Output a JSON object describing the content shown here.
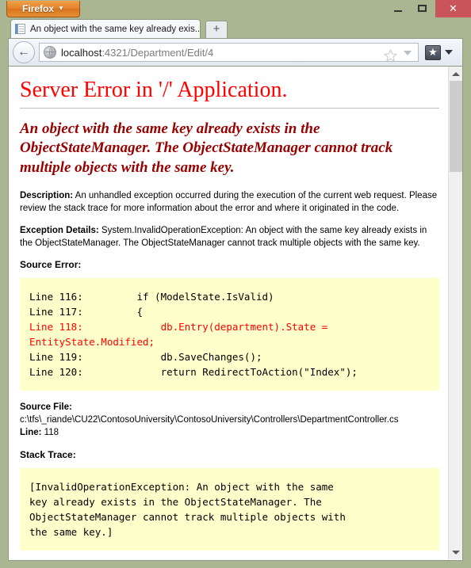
{
  "window": {
    "titlebar": {
      "firefox_button": "Firefox",
      "firefox_caret": "▼",
      "minimize_label": "Minimize",
      "maximize_label": "Maximize",
      "close_label": "✕"
    },
    "colors": {
      "chrome": "#a9b691",
      "close_button": "#c9555a",
      "firefox_orange": "#e2832c",
      "error_red": "#ff0000",
      "message_dark_red": "#990000",
      "code_background": "#ffffcc"
    }
  },
  "tabs": {
    "active": {
      "title": "An object with the same key already exis...",
      "favicon": "document-icon"
    },
    "new_tab_label": "+"
  },
  "navbar": {
    "back_label": "←",
    "url_host": "localhost",
    "url_rest": ":4321/Department/Edit/4",
    "url_full": "localhost:4321/Department/Edit/4",
    "identity_icon": "globe-icon",
    "bookmark_star": "star-icon",
    "url_dropdown": "chevron-down-icon",
    "bookmarks_icon": "bookmarks-star-icon",
    "bookmarks_caret": "chevron-down-icon"
  },
  "page": {
    "title": "Server Error in '/' Application.",
    "message": "An object with the same key already exists in the ObjectStateManager. The ObjectStateManager cannot track multiple objects with the same key.",
    "description_label": "Description:",
    "description_text": " An unhandled exception occurred during the execution of the current web request. Please review the stack trace for more information about the error and where it originated in the code.",
    "exception_label": "Exception Details:",
    "exception_text": " System.InvalidOperationException: An object with the same key already exists in the ObjectStateManager. The ObjectStateManager cannot track multiple objects with the same key.",
    "source_error_heading": "Source Error:",
    "source_lines": [
      {
        "text": "Line 116:         if (ModelState.IsValid)",
        "highlight": false
      },
      {
        "text": "Line 117:         {",
        "highlight": false
      },
      {
        "text": "Line 118:             db.Entry(department).State = EntityState.Modified;",
        "highlight": true
      },
      {
        "text": "Line 119:             db.SaveChanges();",
        "highlight": false
      },
      {
        "text": "Line 120:             return RedirectToAction(\"Index\");",
        "highlight": false
      }
    ],
    "source_file_label": "Source File:",
    "source_file_value": " c:\\tfs\\_riande\\CU22\\ContosoUniversity\\ContosoUniversity\\Controllers\\DepartmentController.cs",
    "line_label": "Line:",
    "line_value": " 118",
    "stack_trace_heading": "Stack Trace:",
    "stack_trace_text": "[InvalidOperationException: An object with the same\nkey already exists in the ObjectStateManager. The\nObjectStateManager cannot track multiple objects with\nthe same key.]"
  },
  "scrollbar": {
    "up_arrow": "chevron-up-icon",
    "down_arrow": "chevron-down-icon",
    "thumb": "scroll-thumb"
  }
}
